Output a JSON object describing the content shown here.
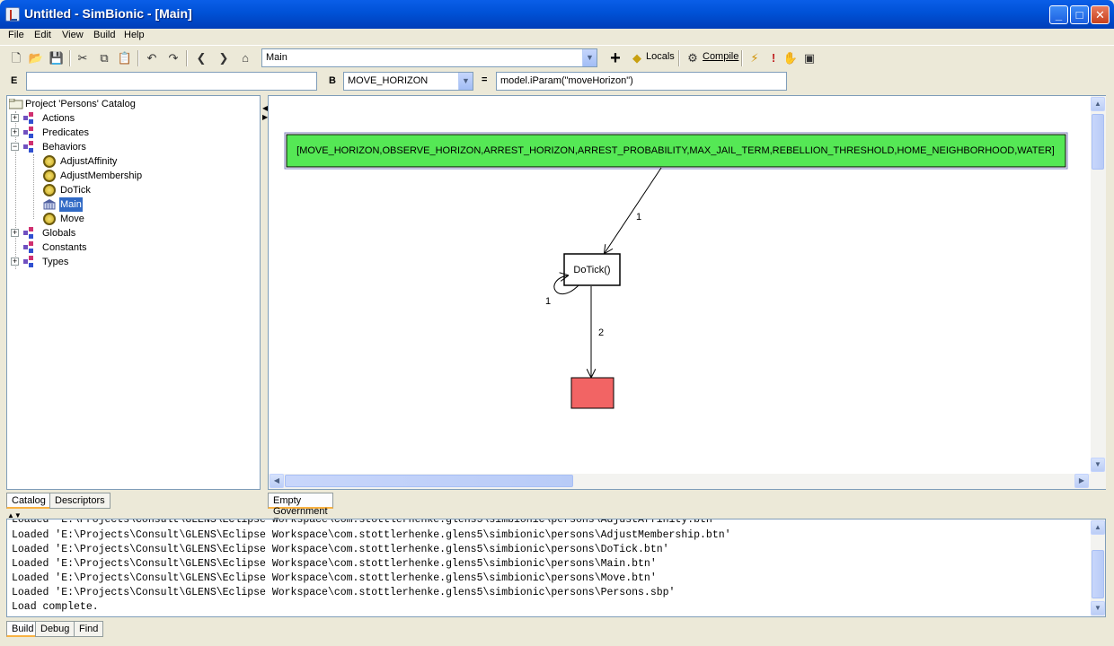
{
  "window": {
    "title": "Untitled - SimBionic - [Main]",
    "minimize": "_",
    "maximize": "□",
    "close": "✕"
  },
  "menu": [
    "File",
    "Edit",
    "View",
    "Build",
    "Help"
  ],
  "toolbar": {
    "behavior_combo": "Main",
    "locals_label": "Locals",
    "compile_label": "Compile",
    "add_symbol": "+"
  },
  "expression": {
    "e_label": "E",
    "e_value": "",
    "b_label": "B",
    "b_combo": "MOVE_HORIZON",
    "equals": "=",
    "b_value": "model.iParam(\"moveHorizon\")"
  },
  "tree": {
    "root": "Project 'Persons' Catalog",
    "actions": "Actions",
    "predicates": "Predicates",
    "behaviors": "Behaviors",
    "behavior_items": [
      "AdjustAffinity",
      "AdjustMembership",
      "DoTick",
      "Main",
      "Move"
    ],
    "globals": "Globals",
    "constants": "Constants",
    "types": "Types"
  },
  "left_tabs": [
    "Catalog",
    "Descriptors"
  ],
  "canvas": {
    "init_node": "[MOVE_HORIZON,OBSERVE_HORIZON,ARREST_HORIZON,ARREST_PROBABILITY,MAX_JAIL_TERM,REBELLION_THRESHOLD,HOME_NEIGHBORHOOD,WATER]",
    "action_node": "DoTick()",
    "edge1_label": "1",
    "loop_label": "1",
    "edge2_label": "2",
    "colors": {
      "init_fill": "#55e855",
      "final_fill": "#f26464"
    }
  },
  "graph_tabs": [
    "Empty Government Force Religion Party Tribe"
  ],
  "console": {
    "lines": [
      "Loaded 'E:\\Projects\\Consult\\GLENS\\Eclipse Workspace\\com.stottlerhenke.glens5\\simbionic\\persons\\AdjustAffinity.btn'",
      "Loaded 'E:\\Projects\\Consult\\GLENS\\Eclipse Workspace\\com.stottlerhenke.glens5\\simbionic\\persons\\AdjustMembership.btn'",
      "Loaded 'E:\\Projects\\Consult\\GLENS\\Eclipse Workspace\\com.stottlerhenke.glens5\\simbionic\\persons\\DoTick.btn'",
      "Loaded 'E:\\Projects\\Consult\\GLENS\\Eclipse Workspace\\com.stottlerhenke.glens5\\simbionic\\persons\\Main.btn'",
      "Loaded 'E:\\Projects\\Consult\\GLENS\\Eclipse Workspace\\com.stottlerhenke.glens5\\simbionic\\persons\\Move.btn'",
      "Loaded 'E:\\Projects\\Consult\\GLENS\\Eclipse Workspace\\com.stottlerhenke.glens5\\simbionic\\persons\\Persons.sbp'",
      "Load complete."
    ]
  },
  "bottom_tabs": [
    "Build",
    "Debug",
    "Find"
  ]
}
